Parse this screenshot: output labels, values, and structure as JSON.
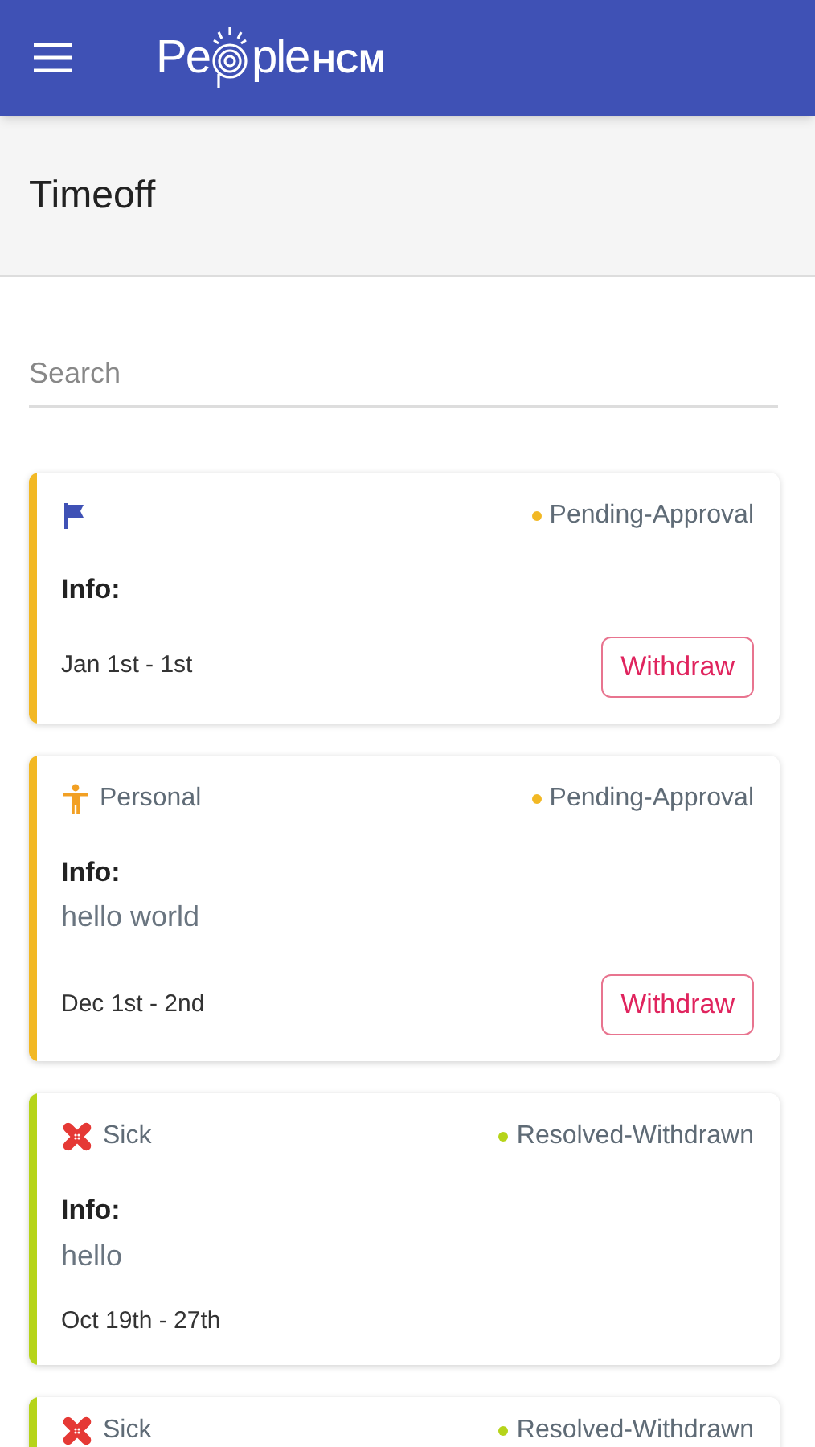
{
  "app_bar": {
    "logo": {
      "start": "Pe",
      "end": "ple",
      "suffix": "HCM"
    }
  },
  "page_title": "Timeoff",
  "search": {
    "placeholder": "Search"
  },
  "requests": [
    {
      "kind": "flag",
      "status": "Pending-Approval",
      "color": "#f2b824",
      "info_label": "Info:",
      "dates": "Jan 1st - 1st",
      "action": "Withdraw"
    },
    {
      "kind": "personal",
      "type": "Personal",
      "status": "Pending-Approval",
      "color": "#f2b824",
      "info_label": "Info:",
      "info": "hello world",
      "dates": "Dec 1st - 2nd",
      "action": "Withdraw"
    },
    {
      "kind": "sick",
      "type": "Sick",
      "status": "Resolved-Withdrawn",
      "color": "#b6d41a",
      "info_label": "Info:",
      "info": "hello",
      "dates": "Oct 19th - 27th"
    },
    {
      "kind": "sick",
      "type": "Sick",
      "status": "Resolved-Withdrawn",
      "color": "#b6d41a"
    }
  ]
}
